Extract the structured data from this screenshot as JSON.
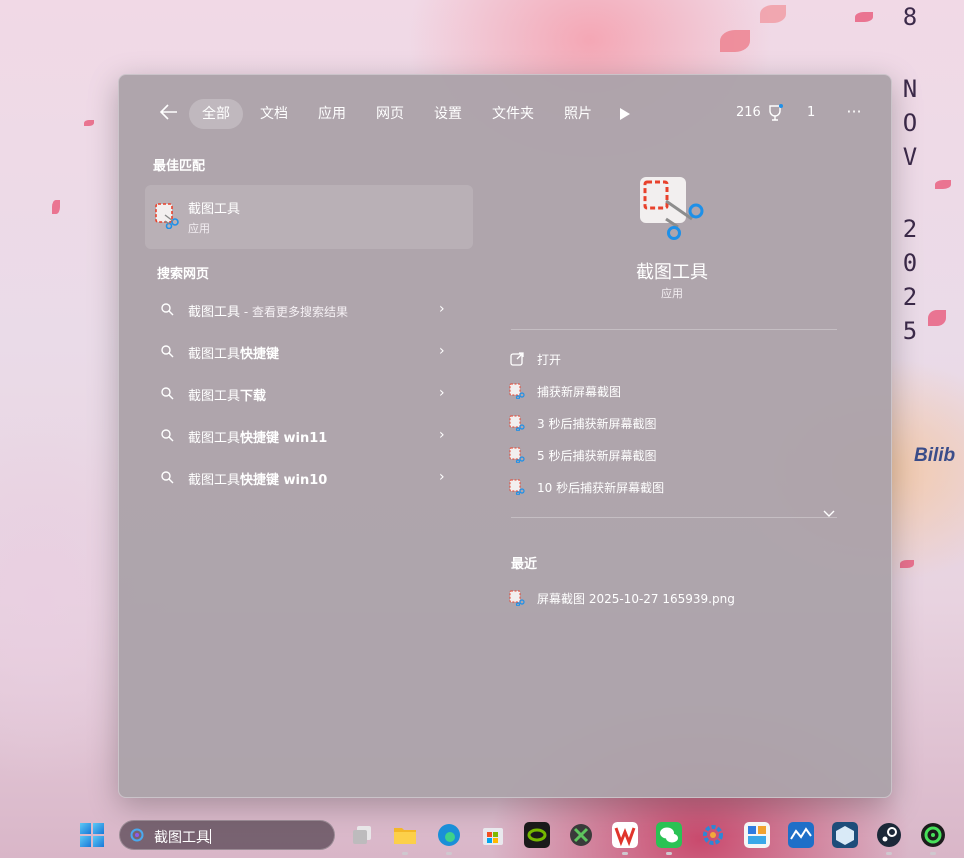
{
  "desktop": {
    "date_vertical": [
      "8",
      "N",
      "O",
      "V",
      "2",
      "0",
      "2",
      "5"
    ],
    "overlay_text": "Bilib"
  },
  "search_panel": {
    "tabs": [
      {
        "label": "全部",
        "active": true
      },
      {
        "label": "文档",
        "active": false
      },
      {
        "label": "应用",
        "active": false
      },
      {
        "label": "网页",
        "active": false
      },
      {
        "label": "设置",
        "active": false
      },
      {
        "label": "文件夹",
        "active": false
      },
      {
        "label": "照片",
        "active": false
      }
    ],
    "reward_points": "216",
    "user_count": "1",
    "more_glyph": "···",
    "best_match": {
      "section_title": "最佳匹配",
      "name": "截图工具",
      "type": "应用"
    },
    "web_search": {
      "section_title": "搜索网页",
      "items": [
        {
          "prefix": "截图工具",
          "suffix": " - 查看更多搜索结果"
        },
        {
          "prefix": "截图工具",
          "suffix": "快捷键"
        },
        {
          "prefix": "截图工具",
          "suffix": "下载"
        },
        {
          "prefix": "截图工具",
          "suffix": "快捷键 win11"
        },
        {
          "prefix": "截图工具",
          "suffix": "快捷键 win10"
        }
      ]
    },
    "preview": {
      "name": "截图工具",
      "type": "应用",
      "actions": [
        {
          "label": "打开",
          "icon": "open-external-icon"
        },
        {
          "label": "捕获新屏幕截图",
          "icon": "snipping-tool-icon"
        },
        {
          "label": "3 秒后捕获新屏幕截图",
          "icon": "snipping-tool-icon"
        },
        {
          "label": "5 秒后捕获新屏幕截图",
          "icon": "snipping-tool-icon"
        },
        {
          "label": "10 秒后捕获新屏幕截图",
          "icon": "snipping-tool-icon"
        }
      ],
      "recent_title": "最近",
      "recent_files": [
        {
          "label": "屏幕截图 2025-10-27 165939.png"
        }
      ]
    }
  },
  "taskbar": {
    "search_value": "截图工具",
    "apps": [
      {
        "name": "task-view-icon"
      },
      {
        "name": "file-explorer-icon"
      },
      {
        "name": "edge-browser-icon"
      },
      {
        "name": "microsoft-store-icon"
      },
      {
        "name": "nvidia-icon"
      },
      {
        "name": "xbox-icon"
      },
      {
        "name": "wps-office-icon"
      },
      {
        "name": "wechat-icon"
      },
      {
        "name": "settings-gear-icon"
      },
      {
        "name": "app-store-icon"
      },
      {
        "name": "wave-app-icon"
      },
      {
        "name": "box-app-icon"
      },
      {
        "name": "steam-icon"
      },
      {
        "name": "green-app-icon"
      }
    ],
    "colors": {
      "accent": "#1e90e8",
      "snip_red": "#e8412c"
    }
  }
}
